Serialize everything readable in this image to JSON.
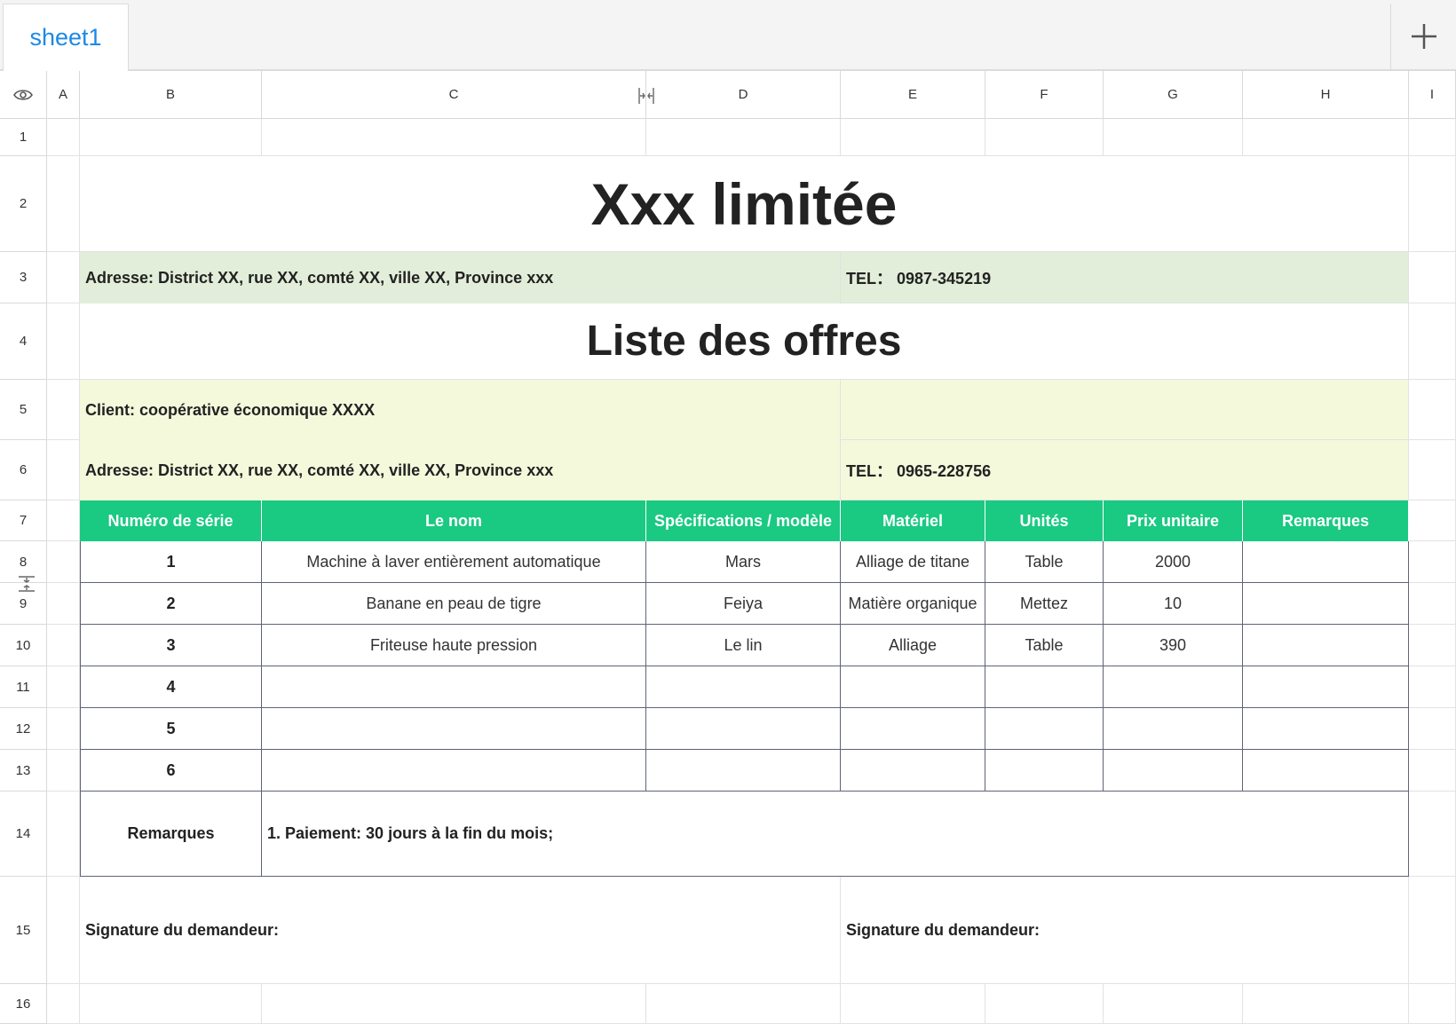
{
  "tabs": [
    {
      "label": "sheet1",
      "active": true
    }
  ],
  "add_sheet_icon": "plus-icon",
  "header_icon": "eye-icon",
  "columns": [
    "A",
    "B",
    "C",
    "D",
    "E",
    "F",
    "G",
    "H",
    "I"
  ],
  "rows": [
    "1",
    "2",
    "3",
    "4",
    "5",
    "6",
    "7",
    "8",
    "9",
    "10",
    "11",
    "12",
    "13",
    "14",
    "15",
    "16"
  ],
  "sheet": {
    "company_title": "Xxx limitée",
    "company_address": "Adresse: District XX, rue XX, comté XX, ville XX, Province xxx",
    "company_tel": "TEL： 0987-345219",
    "list_title": "Liste des offres",
    "client": "Client: coopérative économique XXXX",
    "client_address": "Adresse: District XX, rue XX, comté XX, ville XX, Province xxx",
    "client_tel": "TEL： 0965-228756",
    "table_headers": [
      "Numéro de série",
      "Le nom",
      "Spécifications / modèle",
      "Matériel",
      "Unités",
      "Prix unitaire",
      "Remarques"
    ],
    "table_rows": [
      [
        "1",
        "Machine à laver entièrement automatique",
        "Mars",
        "Alliage de titane",
        "Table",
        "2000",
        ""
      ],
      [
        "2",
        "Banane en peau de tigre",
        "Feiya",
        "Matière organique",
        "Mettez",
        "10",
        ""
      ],
      [
        "3",
        "Friteuse haute pression",
        "Le lin",
        "Alliage",
        "Table",
        "390",
        ""
      ],
      [
        "4",
        "",
        "",
        "",
        "",
        "",
        ""
      ],
      [
        "5",
        "",
        "",
        "",
        "",
        "",
        ""
      ],
      [
        "6",
        "",
        "",
        "",
        "",
        "",
        ""
      ]
    ],
    "remarks_label": "Remarques",
    "remarks_text": "1. Paiement: 30 jours à la fin du mois;",
    "signature_left": "Signature du demandeur:",
    "signature_right": "Signature du demandeur:"
  },
  "colors": {
    "tab_active_text": "#1e88e5",
    "table_header_bg": "#1ac982",
    "company_band_bg": "#e2eed9",
    "client_band_bg": "#f5f9dc",
    "table_border": "#5f6378"
  }
}
